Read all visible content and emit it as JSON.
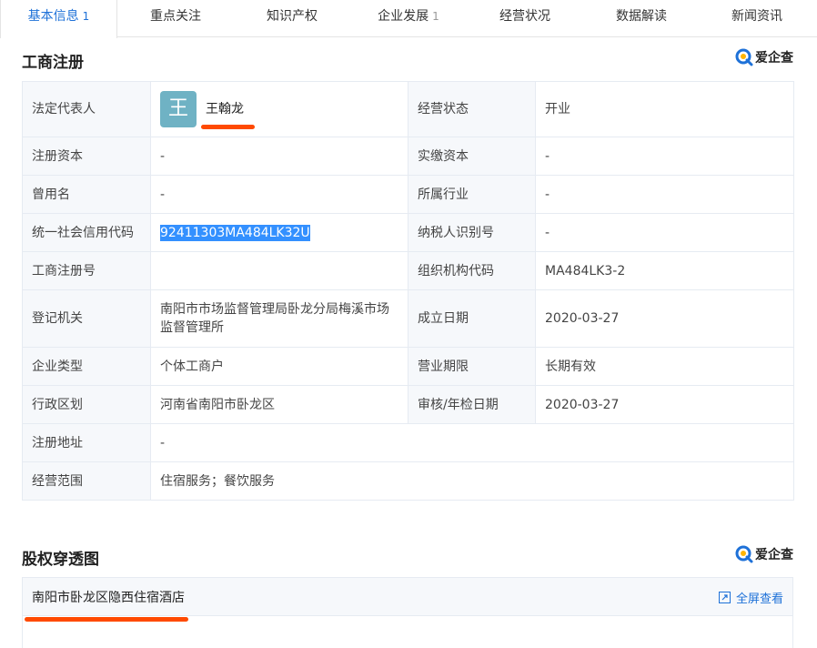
{
  "tabs": [
    {
      "label": "基本信息",
      "count": "1",
      "active": true
    },
    {
      "label": "重点关注",
      "count": "",
      "active": false
    },
    {
      "label": "知识产权",
      "count": "",
      "active": false
    },
    {
      "label": "企业发展",
      "count": "1",
      "active": false
    },
    {
      "label": "经营状况",
      "count": "",
      "active": false
    },
    {
      "label": "数据解读",
      "count": "",
      "active": false
    },
    {
      "label": "新闻资讯",
      "count": "",
      "active": false
    }
  ],
  "brand": {
    "name": "爱企查"
  },
  "registration": {
    "title": "工商注册",
    "legal_rep_label": "法定代表人",
    "legal_rep_avatar": "王",
    "legal_rep_name": "王翰龙",
    "status_label": "经营状态",
    "status_value": "开业",
    "reg_capital_label": "注册资本",
    "reg_capital_value": "-",
    "paid_capital_label": "实缴资本",
    "paid_capital_value": "-",
    "former_name_label": "曾用名",
    "former_name_value": "-",
    "industry_label": "所属行业",
    "industry_value": "-",
    "credit_code_label": "统一社会信用代码",
    "credit_code_value": "92411303MA484LK32U",
    "taxpayer_label": "纳税人识别号",
    "taxpayer_value": "-",
    "reg_no_label": "工商注册号",
    "reg_no_value": "",
    "org_code_label": "组织机构代码",
    "org_code_value": "MA484LK3-2",
    "authority_label": "登记机关",
    "authority_value": "南阳市市场监督管理局卧龙分局梅溪市场监督管理所",
    "found_date_label": "成立日期",
    "found_date_value": "2020-03-27",
    "type_label": "企业类型",
    "type_value": "个体工商户",
    "term_label": "营业期限",
    "term_value": "长期有效",
    "region_label": "行政区划",
    "region_value": "河南省南阳市卧龙区",
    "audit_label": "审核/年检日期",
    "audit_value": "2020-03-27",
    "address_label": "注册地址",
    "address_value": "-",
    "scope_label": "经营范围",
    "scope_value": "住宿服务；餐饮服务"
  },
  "equity": {
    "title": "股权穿透图",
    "company": "南阳市卧龙区隐西住宿酒店",
    "fullscreen_label": "全屏查看"
  },
  "colors": {
    "accent": "#1e71d8",
    "annotation": "#ff4a00",
    "highlight": "#3390ff"
  }
}
